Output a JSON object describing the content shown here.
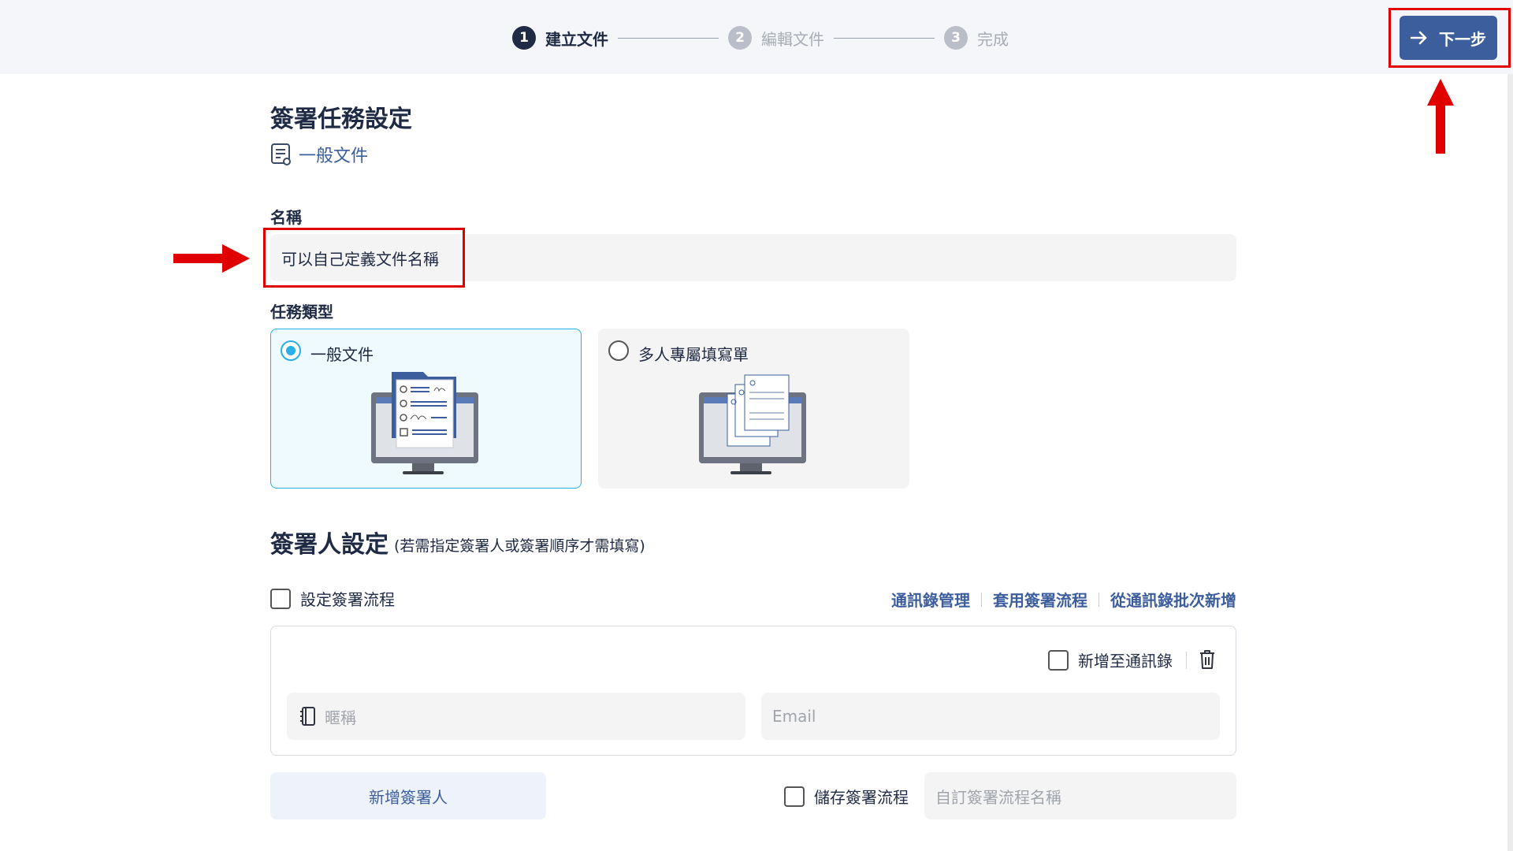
{
  "stepper": {
    "steps": [
      {
        "num": "1",
        "label": "建立文件"
      },
      {
        "num": "2",
        "label": "編輯文件"
      },
      {
        "num": "3",
        "label": "完成"
      }
    ]
  },
  "toolbar": {
    "next_label": "下一步"
  },
  "task_settings": {
    "title": "簽署任務設定",
    "doc_type": "一般文件",
    "name_label": "名稱",
    "name_value": "可以自己定義文件名稱",
    "type_label": "任務類型",
    "type_options": [
      {
        "label": "一般文件",
        "selected": true
      },
      {
        "label": "多人專屬填寫單",
        "selected": false
      }
    ]
  },
  "signer_settings": {
    "title": "簽署人設定",
    "subtitle": "(若需指定簽署人或簽署順序才需填寫)",
    "flow_checkbox_label": "設定簽署流程",
    "links": [
      "通訊錄管理",
      "套用簽署流程",
      "從通訊錄批次新增"
    ],
    "add_to_contacts_label": "新增至通訊錄",
    "nickname_placeholder": "暱稱",
    "email_placeholder": "Email",
    "add_signer_label": "新增簽署人",
    "save_flow_label": "儲存簽署流程",
    "flow_name_placeholder": "自訂簽署流程名稱"
  },
  "colors": {
    "primary": "#3d5e9c",
    "selected_border": "#27b0e5",
    "highlight_red": "#e00000"
  }
}
